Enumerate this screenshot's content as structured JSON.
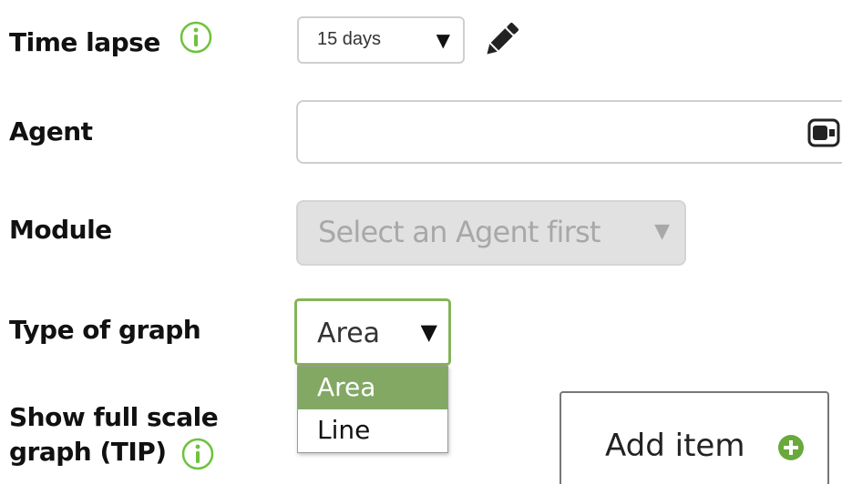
{
  "form": {
    "time_lapse": {
      "label": "Time lapse",
      "value": "15 days"
    },
    "agent": {
      "label": "Agent",
      "value": ""
    },
    "module": {
      "label": "Module",
      "placeholder": "Select an Agent first"
    },
    "type_of_graph": {
      "label": "Type of graph",
      "value": "Area",
      "options": [
        "Area",
        "Line"
      ],
      "selected_option": "Area"
    },
    "show_full_scale": {
      "label_line1": "Show full scale",
      "label_line2": "graph (TIP)"
    },
    "add_item_label": "Add item"
  },
  "icons": {
    "info": "info-icon",
    "edit": "pencil-icon",
    "agent_field": "agent-icon",
    "add": "plus-circle-icon"
  },
  "colors": {
    "accent_green": "#82a864",
    "info_green": "#6ec23c",
    "focus_border": "#86b35a"
  }
}
